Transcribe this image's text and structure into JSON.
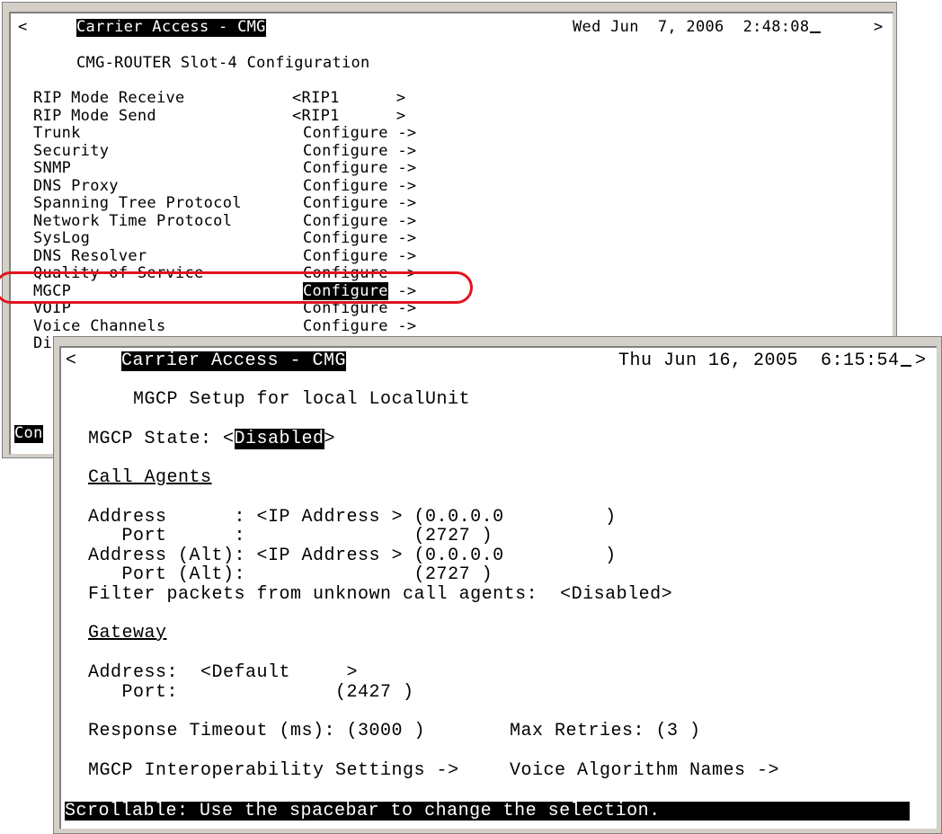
{
  "back_window": {
    "nav_left": "<",
    "title": "Carrier Access - CMG",
    "datetime": "Wed Jun  7, 2006  2:48:08",
    "nav_right": ">",
    "page_title": "CMG-ROUTER Slot-4 Configuration",
    "rows": [
      {
        "label": "RIP Mode Receive",
        "value": "<RIP1      >"
      },
      {
        "label": "RIP Mode Send",
        "value": "<RIP1      >"
      },
      {
        "label": "Trunk",
        "value": "Configure ->"
      },
      {
        "label": "Security",
        "value": "Configure ->"
      },
      {
        "label": "SNMP",
        "value": "Configure ->"
      },
      {
        "label": "DNS Proxy",
        "value": "Configure ->"
      },
      {
        "label": "Spanning Tree Protocol",
        "value": "Configure ->"
      },
      {
        "label": "Network Time Protocol",
        "value": "Configure ->"
      },
      {
        "label": "SysLog",
        "value": "Configure ->"
      },
      {
        "label": "DNS Resolver",
        "value": "Configure ->"
      },
      {
        "label": "Quality of Service",
        "value": "Configure ->"
      },
      {
        "label": "MGCP",
        "value": "Configure",
        "suffix": " ->",
        "selected": true
      },
      {
        "label": "VOIP",
        "value": "Configure ->"
      },
      {
        "label": "Voice Channels",
        "value": "Configure ->"
      },
      {
        "label": "Di",
        "value": ""
      }
    ],
    "status_fragment": "Con"
  },
  "front_window": {
    "nav_left": "<",
    "title": "Carrier Access - CMG",
    "datetime": "Thu Jun 16, 2005  6:15:54",
    "nav_right": ">",
    "page_title": "MGCP Setup for local LocalUnit",
    "mgcp_state": {
      "label": "MGCP State: <",
      "value": "Disabled",
      "suffix": ">"
    },
    "call_agents": {
      "heading": "Call Agents",
      "address": "Address      : <IP Address > (0.0.0.0         )",
      "port": "   Port      :               (2727 )",
      "address_alt": "Address (Alt): <IP Address > (0.0.0.0         )",
      "port_alt": "   Port (Alt):               (2727 )",
      "filter": "Filter packets from unknown call agents:  <Disabled>"
    },
    "gateway": {
      "heading": "Gateway",
      "address": "Address:  <Default     >",
      "port": "   Port:              (2427 )"
    },
    "response_timeout": "Response Timeout (ms): (3000 )",
    "max_retries": "Max Retries: (3 )",
    "interop_link": "MGCP Interoperability Settings ->",
    "voice_algo_link": "Voice Algorithm Names ->",
    "status_message": "Scrollable: Use the spacebar to change the selection."
  },
  "colors": {
    "highlight": "#e0141e",
    "window_chrome": "#d4d0c8",
    "terminal_bg": "#ffffff",
    "terminal_fg": "#000000"
  }
}
